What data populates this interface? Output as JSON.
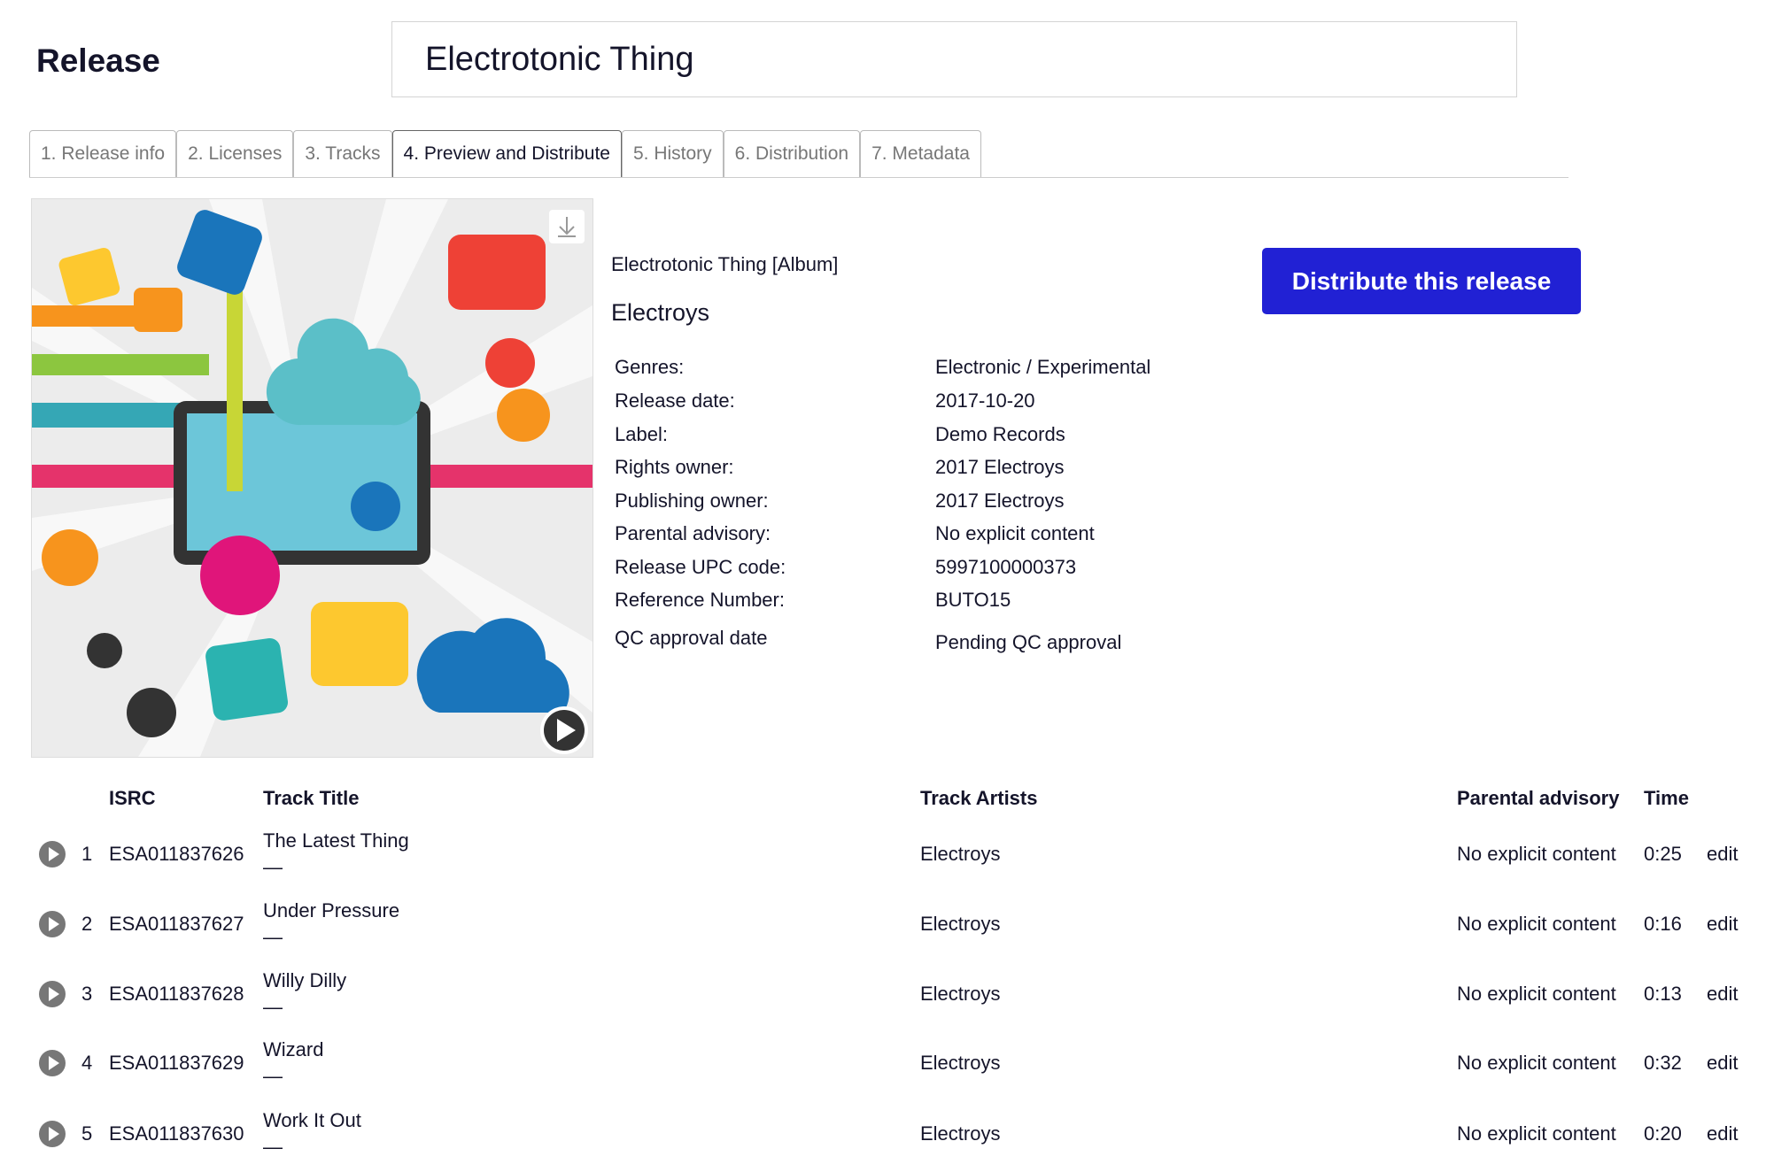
{
  "header": {
    "title": "Release",
    "release_name": "Electrotonic Thing"
  },
  "tabs": [
    {
      "label": "1. Release info"
    },
    {
      "label": "2. Licenses"
    },
    {
      "label": "3. Tracks"
    },
    {
      "label": "4. Preview and Distribute",
      "active": true
    },
    {
      "label": "5. History"
    },
    {
      "label": "6. Distribution"
    },
    {
      "label": "7. Metadata"
    }
  ],
  "preview": {
    "album_line": "Electrotonic Thing [Album]",
    "artist": "Electroys",
    "distribute_label": "Distribute this release",
    "cover_icons": [
      "download-icon",
      "play-icon"
    ]
  },
  "details": [
    {
      "label": "Genres:",
      "value": "Electronic / Experimental"
    },
    {
      "label": "Release date:",
      "value": "2017-10-20"
    },
    {
      "label": "Label:",
      "value": "Demo Records"
    },
    {
      "label": "Rights owner:",
      "value": "2017 Electroys"
    },
    {
      "label": "Publishing owner:",
      "value": "2017 Electroys"
    },
    {
      "label": "Parental advisory:",
      "value": "No explicit content"
    },
    {
      "label": "Release UPC code:",
      "value": "5997100000373"
    },
    {
      "label": "Reference Number:",
      "value": "BUTO15"
    },
    {
      "label": "QC approval date",
      "value": "Pending QC approval"
    }
  ],
  "tracks": {
    "headers": {
      "isrc": "ISRC",
      "title": "Track Title",
      "artists": "Track Artists",
      "parental": "Parental advisory",
      "time": "Time"
    },
    "rows": [
      {
        "num": "1",
        "isrc": "ESA011837626",
        "title": "The Latest Thing",
        "sub": "—",
        "artists": "Electroys",
        "parental": "No explicit content",
        "time": "0:25",
        "edit": "edit"
      },
      {
        "num": "2",
        "isrc": "ESA011837627",
        "title": "Under Pressure",
        "sub": "—",
        "artists": "Electroys",
        "parental": "No explicit content",
        "time": "0:16",
        "edit": "edit"
      },
      {
        "num": "3",
        "isrc": "ESA011837628",
        "title": "Willy Dilly",
        "sub": "—",
        "artists": "Electroys",
        "parental": "No explicit content",
        "time": "0:13",
        "edit": "edit"
      },
      {
        "num": "4",
        "isrc": "ESA011837629",
        "title": "Wizard",
        "sub": "—",
        "artists": "Electroys",
        "parental": "No explicit content",
        "time": "0:32",
        "edit": "edit"
      },
      {
        "num": "5",
        "isrc": "ESA011837630",
        "title": "Work It Out",
        "sub": "—",
        "artists": "Electroys",
        "parental": "No explicit content",
        "time": "0:20",
        "edit": "edit"
      }
    ]
  },
  "colors": {
    "accent": "#2121d4"
  }
}
